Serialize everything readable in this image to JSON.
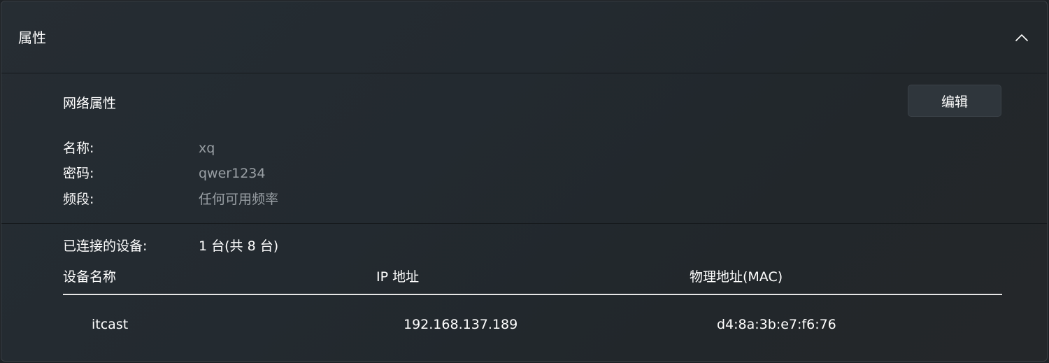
{
  "header": {
    "title": "属性",
    "collapse_icon": "chevron-up-icon"
  },
  "network_properties": {
    "title": "网络属性",
    "edit_label": "编辑",
    "fields": [
      {
        "label": "名称:",
        "value": "xq"
      },
      {
        "label": "密码:",
        "value": "qwer1234"
      },
      {
        "label": "频段:",
        "value": "任何可用频率"
      }
    ]
  },
  "devices": {
    "connected_label": "已连接的设备:",
    "connected_value": "1 台(共 8 台)",
    "columns": [
      "设备名称",
      "IP 地址",
      "物理地址(MAC)"
    ],
    "rows": [
      {
        "name": "itcast",
        "ip": "192.168.137.189",
        "mac": "d4:8a:3b:e7:f6:76"
      }
    ]
  },
  "colors": {
    "background": "#22282d",
    "value_text": "#9aa0a5",
    "button_bg": "#2f363c"
  }
}
